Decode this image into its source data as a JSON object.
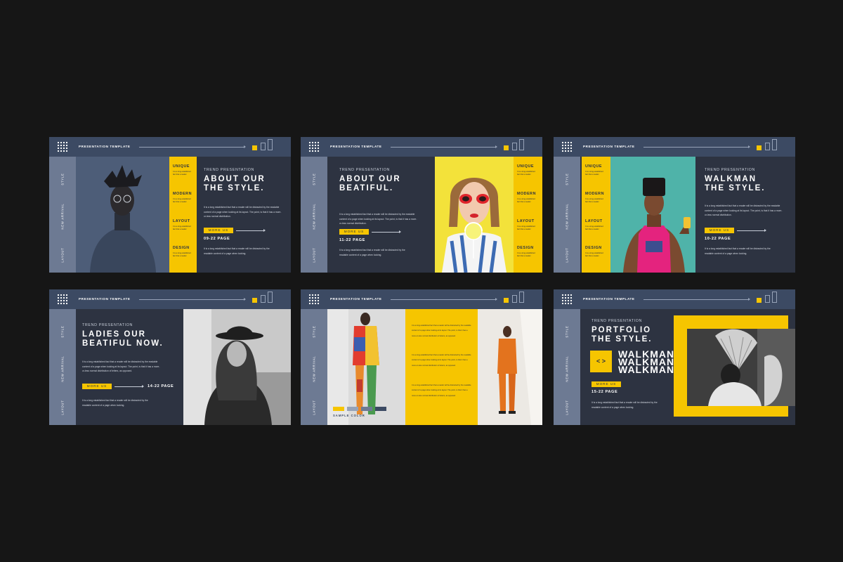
{
  "common": {
    "header": "PRESENTATION TEMPLATE",
    "side_labels": [
      "STYLE",
      "NEW ARRIVAL",
      "LAYOUT"
    ],
    "more_us": "MORE US",
    "trend": "TREND PRESENTATION"
  },
  "yellow_items": [
    {
      "label": "UNIQUE",
      "text": "It is a long established fact that a reader"
    },
    {
      "label": "MODERN",
      "text": "It is a long established fact that a reader"
    },
    {
      "label": "LAYOUT",
      "text": "It is a long established fact that a reader"
    },
    {
      "label": "DESIGN",
      "text": "It is a long established fact that a reader"
    }
  ],
  "para_long": "It is a long established fact that a reader will be distracted by the readable content of a page when looking at its layout. The point, is that it has a more-or-less normal distribution.",
  "para_short": "It is a long established fact that a reader will be distracted by the readable content of a page when looking.",
  "para_ladies": "It is a long established fact that a reader will be distracted by the readable content of a page when looking at its layout. The point, is that it has a more-or-less normal distribution of letters, as opposed.",
  "para_yellow": "It is a long established fact that a reader will be distracted by the readable content of a page when looking at its layout. The point, is that it has a more-or-less normal distribution of letters, as opposed.",
  "slides": {
    "s1": {
      "title_1": "ABOUT OUR",
      "title_2": "THE STYLE.",
      "page": "09-22 PAGE"
    },
    "s2": {
      "title_1": "ABOUT OUR",
      "title_2": "BEATIFUL.",
      "page": "11-22 PAGE"
    },
    "s3": {
      "title_1": "WALKMAN",
      "title_2": "THE STYLE.",
      "page": "10-22 PAGE"
    },
    "s4": {
      "title_1": "LADIES OUR",
      "title_2": "BEATIFUL NOW.",
      "page": "14-22 PAGE"
    },
    "s5": {
      "sample": "SAMPLE COLOR"
    },
    "s6": {
      "title_1": "PORTFOLIO",
      "title_2": "THE STYLE.",
      "walkman": [
        "WALKMAN",
        "WALKMAN",
        "WALKMAN"
      ],
      "code": "< >",
      "page": "15-22 PAGE"
    }
  },
  "colors": {
    "yellow": "#f6c500",
    "navy": "#2d3341",
    "header": "#3c4a63",
    "side": "#6d7a93"
  }
}
